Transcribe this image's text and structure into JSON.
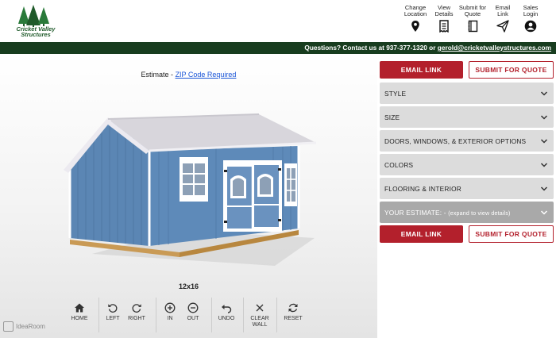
{
  "brand": {
    "name": "Cricket Valley Structures",
    "brand_color": "#1f5a2a"
  },
  "nav": [
    {
      "label": "Change Location",
      "icon": "location-pin-icon"
    },
    {
      "label": "View Details",
      "icon": "receipt-icon"
    },
    {
      "label": "Submit for Quote",
      "icon": "notebook-icon"
    },
    {
      "label": "Email Link",
      "icon": "paper-plane-icon"
    },
    {
      "label": "Sales Login",
      "icon": "user-circle-icon"
    }
  ],
  "infobar": {
    "text": "Questions? Contact us at 937-377-1320 or ",
    "email": "gerold@cricketvalleystructures.com",
    "color": "#183d1f"
  },
  "estimate": {
    "label": "Estimate - ",
    "zip": "ZIP Code Required"
  },
  "model": {
    "size": "12x16",
    "wall_color": "#5b86b4",
    "trim_color": "#ffffff",
    "roof_color": "#d8d6dc"
  },
  "toolbar": [
    {
      "label": "HOME",
      "icon": "home-icon"
    },
    {
      "label": "LEFT",
      "icon": "rotate-left-icon"
    },
    {
      "label": "RIGHT",
      "icon": "rotate-right-icon"
    },
    {
      "label": "IN",
      "icon": "zoom-in-icon"
    },
    {
      "label": "OUT",
      "icon": "zoom-out-icon"
    },
    {
      "label": "UNDO",
      "icon": "undo-icon"
    },
    {
      "label": "CLEAR WALL",
      "icon": "close-icon"
    },
    {
      "label": "RESET",
      "icon": "reset-icon"
    }
  ],
  "footer": {
    "powered_by": "IdeaRoom"
  },
  "actions": {
    "email_link": "EMAIL LINK",
    "submit_quote": "SUBMIT FOR QUOTE",
    "accent": "#b3202c"
  },
  "accordion": [
    {
      "label": "STYLE"
    },
    {
      "label": "SIZE"
    },
    {
      "label": "DOORS, WINDOWS, & EXTERIOR OPTIONS"
    },
    {
      "label": "COLORS"
    },
    {
      "label": "FLOORING & INTERIOR"
    }
  ],
  "your_estimate": {
    "label": "YOUR ESTIMATE: - ",
    "hint": "(expand to view details)"
  }
}
